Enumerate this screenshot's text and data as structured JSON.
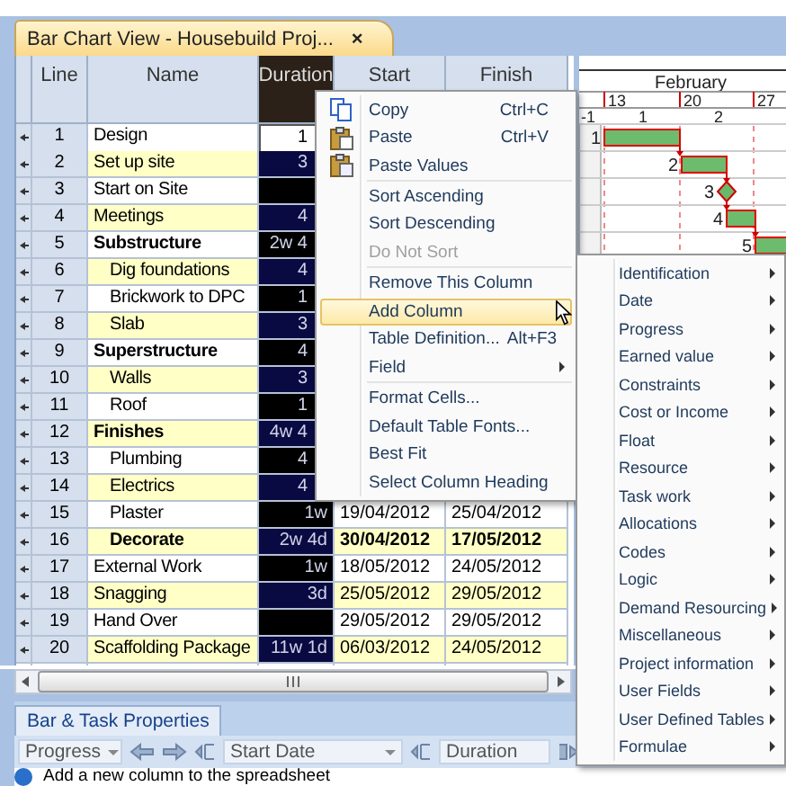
{
  "document_tab": {
    "title": "Bar Chart View - Housebuild Proj...",
    "close": "×"
  },
  "columns": [
    {
      "label": "Line",
      "selected": false
    },
    {
      "label": "Name",
      "selected": false
    },
    {
      "label": "Duration",
      "selected": true
    },
    {
      "label": "Start",
      "selected": false
    },
    {
      "label": "Finish",
      "selected": false
    }
  ],
  "tasks": [
    {
      "line": "1",
      "name": "Design",
      "kind": "task",
      "duration": "1",
      "selected": true
    },
    {
      "line": "2",
      "name": "Set up site",
      "kind": "task",
      "duration": "3",
      "selected": false
    },
    {
      "line": "3",
      "name": "Start on Site",
      "kind": "task",
      "selected": false
    },
    {
      "line": "4",
      "name": "Meetings",
      "kind": "task",
      "duration": "4",
      "selected": false
    },
    {
      "line": "5",
      "name": "Substructure",
      "kind": "summary",
      "duration": "2w 4",
      "selected": false,
      "children": [
        {
          "line": "6",
          "name": "Dig foundations",
          "kind": "task",
          "duration": "4",
          "selected": false
        },
        {
          "line": "7",
          "name": "Brickwork to DPC",
          "kind": "task",
          "duration": "1",
          "selected": false
        },
        {
          "line": "8",
          "name": "Slab",
          "kind": "task",
          "duration": "3",
          "selected": false
        }
      ]
    },
    {
      "line": "9",
      "name": "Superstructure",
      "kind": "summary",
      "duration": "4",
      "selected": false,
      "children": [
        {
          "line": "10",
          "name": "Walls",
          "kind": "task",
          "duration": "3",
          "selected": false
        },
        {
          "line": "11",
          "name": "Roof",
          "kind": "task",
          "duration": "1",
          "selected": false
        }
      ]
    },
    {
      "line": "12",
      "name": "Finishes",
      "kind": "summary",
      "duration": "4w 4",
      "selected": false,
      "children": [
        {
          "line": "13",
          "name": "Plumbing",
          "kind": "task",
          "duration": "4",
          "selected": false
        },
        {
          "line": "14",
          "name": "Electrics",
          "kind": "task",
          "duration": "4",
          "selected": false
        },
        {
          "line": "15",
          "name": "Plaster",
          "kind": "task",
          "duration": "1w",
          "start": "19/04/2012",
          "finish": "25/04/2012",
          "selected": false
        },
        {
          "line": "16",
          "name": "Decorate",
          "kind": "summary",
          "duration": "2w 4d",
          "start": "30/04/2012",
          "finish": "17/05/2012",
          "selected": false
        }
      ]
    },
    {
      "line": "17",
      "name": "External Work",
      "kind": "task",
      "duration": "1w",
      "start": "18/05/2012",
      "finish": "24/05/2012",
      "selected": false
    },
    {
      "line": "18",
      "name": "Snagging",
      "kind": "task",
      "duration": "3d",
      "start": "25/05/2012",
      "finish": "29/05/2012",
      "selected": false
    },
    {
      "line": "19",
      "name": "Hand Over",
      "kind": "task",
      "start": "29/05/2012",
      "finish": "29/05/2012",
      "selected": false
    },
    {
      "line": "20",
      "name": "Scaffolding Package",
      "kind": "task",
      "duration": "11w 1d",
      "start": "06/03/2012",
      "finish": "24/05/2012",
      "selected": false
    }
  ],
  "gantt": {
    "month": "February",
    "week_dates": [
      "13",
      "20",
      "27"
    ],
    "week_numbers": [
      "-1",
      "1",
      "2"
    ],
    "bars": [
      {
        "label": "1",
        "kind": "bar"
      },
      {
        "label": "2",
        "kind": "bar"
      },
      {
        "label": "3",
        "kind": "milestone"
      },
      {
        "label": "4",
        "kind": "bar"
      },
      {
        "label": "5",
        "kind": "bar"
      }
    ]
  },
  "context_menu": [
    {
      "kind": "item",
      "label": "Copy",
      "shortcut": "Ctrl+C",
      "disabled": false,
      "selected": false
    },
    {
      "kind": "item",
      "label": "Paste",
      "shortcut": "Ctrl+V",
      "disabled": false,
      "selected": false
    },
    {
      "kind": "item",
      "label": "Paste Values",
      "disabled": false,
      "selected": false
    },
    {
      "kind": "separator"
    },
    {
      "kind": "item",
      "label": "Sort Ascending",
      "disabled": false,
      "selected": false
    },
    {
      "kind": "item",
      "label": "Sort Descending",
      "disabled": false,
      "selected": false
    },
    {
      "kind": "item",
      "label": "Do Not Sort",
      "disabled": true,
      "selected": false
    },
    {
      "kind": "separator"
    },
    {
      "kind": "item",
      "label": "Remove This Column",
      "disabled": false,
      "selected": false
    },
    {
      "kind": "item",
      "label": "Add Column",
      "submenu": true,
      "disabled": false,
      "selected": true
    },
    {
      "kind": "item",
      "label": "Table Definition...",
      "shortcut": "Alt+F3",
      "disabled": false,
      "selected": false
    },
    {
      "kind": "item",
      "label": "Field",
      "submenu": true,
      "disabled": false,
      "selected": false
    },
    {
      "kind": "separator"
    },
    {
      "kind": "item",
      "label": "Format Cells...",
      "disabled": false,
      "selected": false
    },
    {
      "kind": "item",
      "label": "Default Table Fonts...",
      "disabled": false,
      "selected": false
    },
    {
      "kind": "item",
      "label": "Best Fit",
      "disabled": false,
      "selected": false
    },
    {
      "kind": "item",
      "label": "Select Column Heading",
      "disabled": false,
      "selected": false
    }
  ],
  "submenu": [
    {
      "kind": "item",
      "label": "Identification",
      "submenu": true,
      "disabled": false,
      "selected": false
    },
    {
      "kind": "item",
      "label": "Date",
      "submenu": true,
      "disabled": false,
      "selected": false
    },
    {
      "kind": "item",
      "label": "Progress",
      "submenu": true,
      "disabled": false,
      "selected": false
    },
    {
      "kind": "item",
      "label": "Earned value",
      "submenu": true,
      "disabled": false,
      "selected": false
    },
    {
      "kind": "item",
      "label": "Constraints",
      "submenu": true,
      "disabled": false,
      "selected": false
    },
    {
      "kind": "item",
      "label": "Cost or Income",
      "submenu": true,
      "disabled": false,
      "selected": false
    },
    {
      "kind": "item",
      "label": "Float",
      "submenu": true,
      "disabled": false,
      "selected": false
    },
    {
      "kind": "item",
      "label": "Resource",
      "submenu": true,
      "disabled": false,
      "selected": false
    },
    {
      "kind": "item",
      "label": "Task work",
      "submenu": true,
      "disabled": false,
      "selected": false
    },
    {
      "kind": "item",
      "label": "Allocations",
      "submenu": true,
      "disabled": false,
      "selected": false
    },
    {
      "kind": "item",
      "label": "Codes",
      "submenu": true,
      "disabled": false,
      "selected": false
    },
    {
      "kind": "item",
      "label": "Logic",
      "submenu": true,
      "disabled": false,
      "selected": false
    },
    {
      "kind": "item",
      "label": "Demand Resourcing",
      "submenu": true,
      "disabled": false,
      "selected": false
    },
    {
      "kind": "item",
      "label": "Miscellaneous",
      "submenu": true,
      "disabled": false,
      "selected": false
    },
    {
      "kind": "item",
      "label": "Project information",
      "submenu": true,
      "disabled": false,
      "selected": false
    },
    {
      "kind": "item",
      "label": "User Fields",
      "submenu": true,
      "disabled": false,
      "selected": false
    },
    {
      "kind": "item",
      "label": "User Defined Tables",
      "submenu": true,
      "disabled": false,
      "selected": false
    },
    {
      "kind": "item",
      "label": "Formulae",
      "submenu": true,
      "disabled": false,
      "selected": false
    }
  ],
  "properties_panel": {
    "tab": "Bar & Task Properties",
    "progress_combo": "Progress",
    "date_combo": "Start Date",
    "duration_field": "Duration"
  },
  "status_bar": "Add a new column to the spreadsheet"
}
